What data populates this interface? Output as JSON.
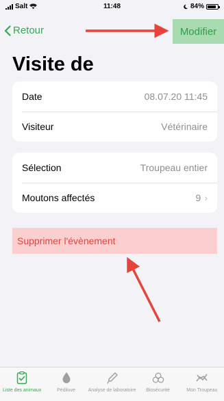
{
  "status_bar": {
    "carrier": "Salt",
    "time": "11:48",
    "battery_percent": "84%",
    "battery_level": 0.84
  },
  "nav": {
    "back_label": "Retour",
    "modify_label": "Modifier"
  },
  "page_title": "Visite de",
  "details": {
    "date_label": "Date",
    "date_value": "08.07.20 11:45",
    "visitor_label": "Visiteur",
    "visitor_value": "Vétérinaire"
  },
  "selection": {
    "selection_label": "Sélection",
    "selection_value": "Troupeau entier",
    "affected_label": "Moutons affectés",
    "affected_value": "9"
  },
  "delete_label": "Supprimer l'évènement",
  "tabs": [
    {
      "label": "Liste des animaux",
      "icon": "clipboard-check-icon",
      "active": true
    },
    {
      "label": "Pédiluve",
      "icon": "drop-icon",
      "active": false
    },
    {
      "label": "Analyse de laboratoire",
      "icon": "pipette-icon",
      "active": false
    },
    {
      "label": "Biosécurité",
      "icon": "biohazard-icon",
      "active": false
    },
    {
      "label": "Mon Troupeau",
      "icon": "chart-icon",
      "active": false
    }
  ],
  "colors": {
    "accent": "#34a853",
    "annotation_arrow": "#e8433a",
    "delete_highlight": "#fbcfd0",
    "modify_highlight": "#a8dbb2"
  }
}
